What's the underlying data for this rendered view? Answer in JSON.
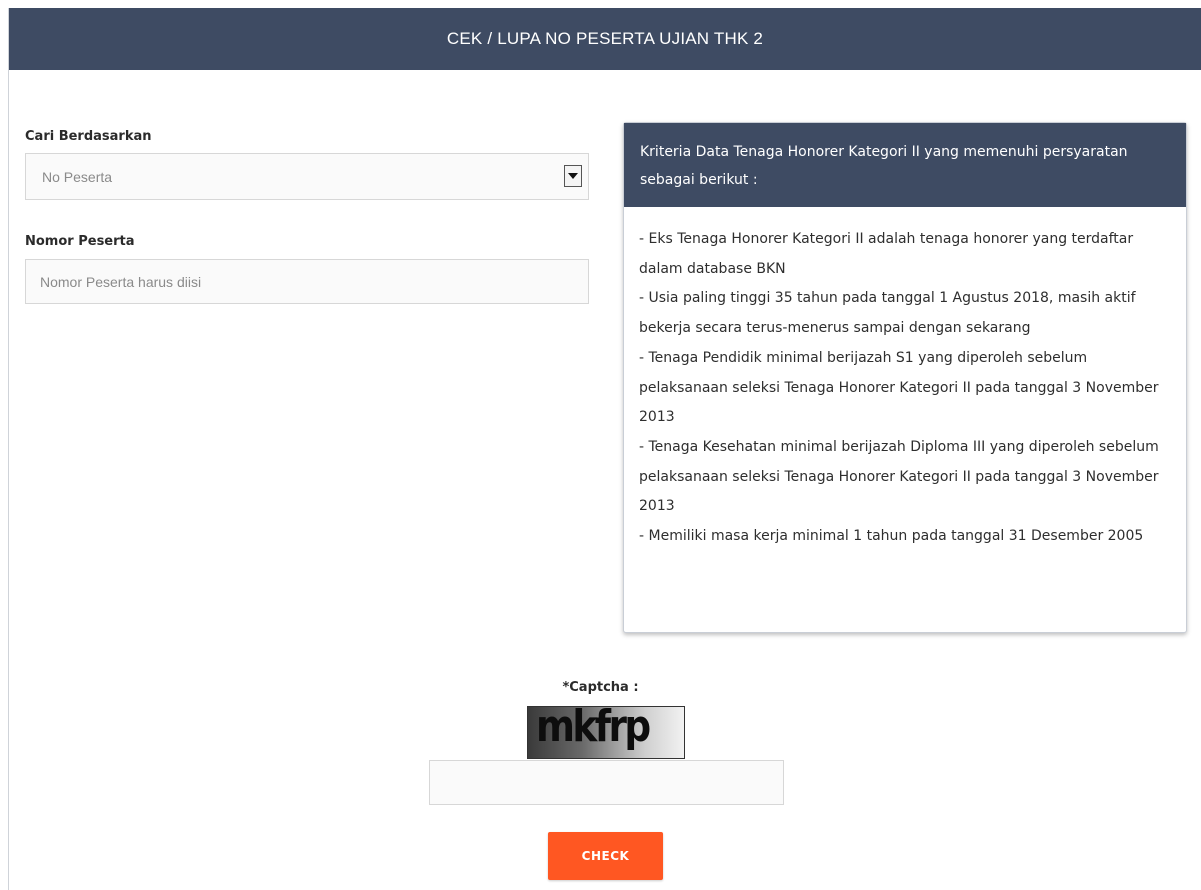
{
  "header": {
    "title": "CEK / LUPA NO PESERTA UJIAN THK 2"
  },
  "form": {
    "search_by_label": "Cari Berdasarkan",
    "search_by_selected": "No Peserta",
    "participant_label": "Nomor Peserta",
    "participant_placeholder": "Nomor Peserta harus diisi",
    "participant_value": "",
    "captcha_label": "*Captcha :",
    "captcha_image_text": "mkfrp",
    "captcha_input_value": "",
    "submit_label": "CHECK"
  },
  "criteria": {
    "heading": "Kriteria Data Tenaga Honorer Kategori II yang memenuhi persyaratan sebagai berikut :",
    "items": [
      "- Eks Tenaga Honorer Kategori II adalah tenaga honorer yang terdaftar dalam database BKN",
      "- Usia paling tinggi 35 tahun pada tanggal 1 Agustus 2018, masih aktif bekerja secara terus-menerus sampai dengan sekarang",
      "- Tenaga Pendidik minimal berijazah S1 yang diperoleh sebelum pelaksanaan seleksi Tenaga Honorer Kategori II pada tanggal 3 November 2013",
      "- Tenaga Kesehatan minimal berijazah Diploma III yang diperoleh sebelum pelaksanaan seleksi Tenaga Honorer Kategori II pada tanggal 3 November 2013",
      "- Memiliki masa kerja minimal 1 tahun pada tanggal 31 Desember 2005"
    ]
  },
  "colors": {
    "header_bg": "#3e4b63",
    "button_bg": "#ff5722"
  },
  "icons": {
    "select_caret": "caret-down-icon"
  }
}
